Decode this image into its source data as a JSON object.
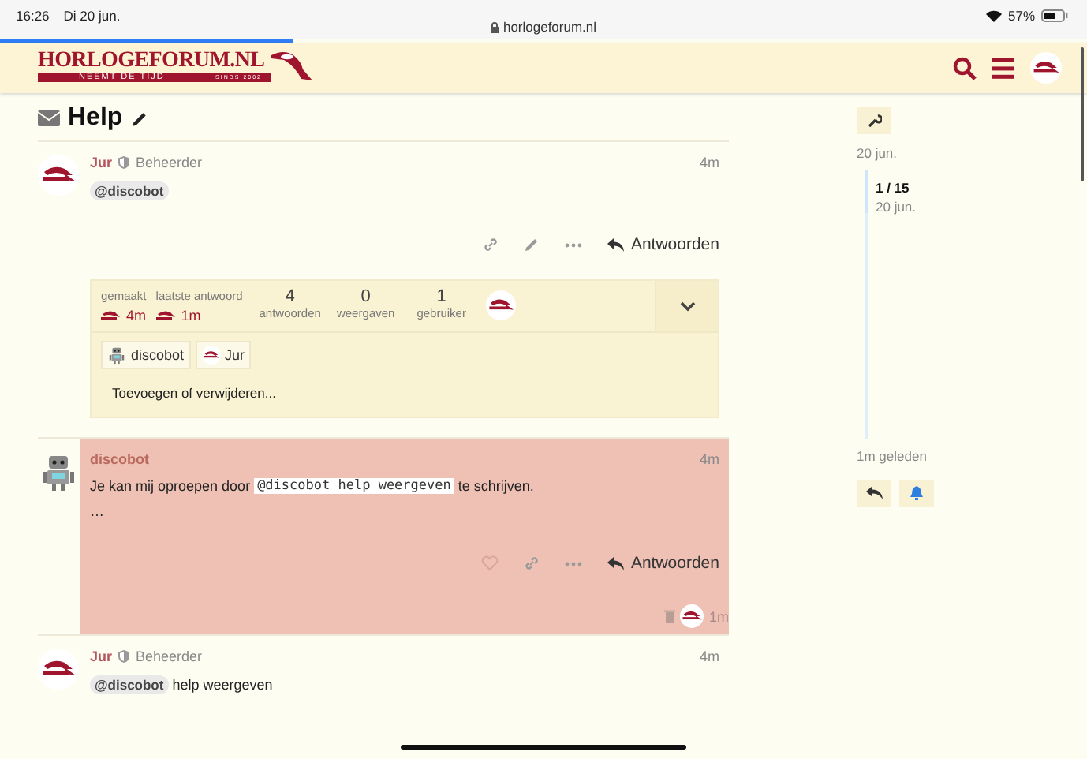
{
  "status_bar": {
    "time": "16:26",
    "date": "Di 20 jun.",
    "url": "horlogeforum.nl",
    "battery": "57%"
  },
  "load_progress": {
    "level": 0.27
  },
  "header": {
    "logo_title": "HORLOGEFORUM.NL",
    "logo_tagline": "NEEMT DE TIJD",
    "logo_since": "SINDS 2002"
  },
  "topic": {
    "title": "Help"
  },
  "posts": [
    {
      "kind": "user",
      "username": "Jur",
      "moderator": true,
      "user_title": "Beheerder",
      "age": "4m",
      "highlighted": false,
      "body": [
        [
          {
            "kind": "mention",
            "text": "@discobot"
          }
        ]
      ],
      "actions": [
        {
          "kind": "link"
        },
        {
          "kind": "edit"
        },
        {
          "kind": "more"
        }
      ],
      "reply": "Antwoorden",
      "topic_map": true
    },
    {
      "kind": "bot",
      "username": "discobot",
      "moderator": false,
      "age": "4m",
      "highlighted": true,
      "body": [
        [
          {
            "kind": "text",
            "text": "Je kan mij oproepen door "
          },
          {
            "kind": "code",
            "text": "@discobot help weergeven"
          },
          {
            "kind": "text",
            "text": " te schrijven."
          }
        ],
        [
          {
            "kind": "text",
            "text": "…"
          }
        ]
      ],
      "actions": [
        {
          "kind": "like"
        },
        {
          "kind": "link"
        },
        {
          "kind": "more"
        }
      ],
      "reply": "Antwoorden",
      "deleted_age": "1m"
    },
    {
      "kind": "user",
      "username": "Jur",
      "moderator": true,
      "user_title": "Beheerder",
      "age": "4m",
      "highlighted": false,
      "body": [
        [
          {
            "kind": "mention",
            "text": "@discobot"
          },
          {
            "kind": "text",
            "text": " help weergeven"
          }
        ]
      ]
    }
  ],
  "topic_map": {
    "created": {
      "label": "gemaakt",
      "value": "4m"
    },
    "last_reply": {
      "label": "laatste antwoord",
      "value": "1m"
    },
    "counts": [
      {
        "number": "4",
        "label": "antwoorden"
      },
      {
        "number": "0",
        "label": "weergaven"
      },
      {
        "number": "1",
        "label": "gebruiker"
      }
    ],
    "participants": [
      {
        "name": "discobot",
        "kind": "bot"
      },
      {
        "name": "Jur",
        "kind": "user"
      }
    ],
    "add_remove": "Toevoegen of verwijderen..."
  },
  "timeline": {
    "start_date": "20 jun.",
    "position": "1 / 15",
    "position_date": "20 jun.",
    "end": "1m geleden"
  }
}
